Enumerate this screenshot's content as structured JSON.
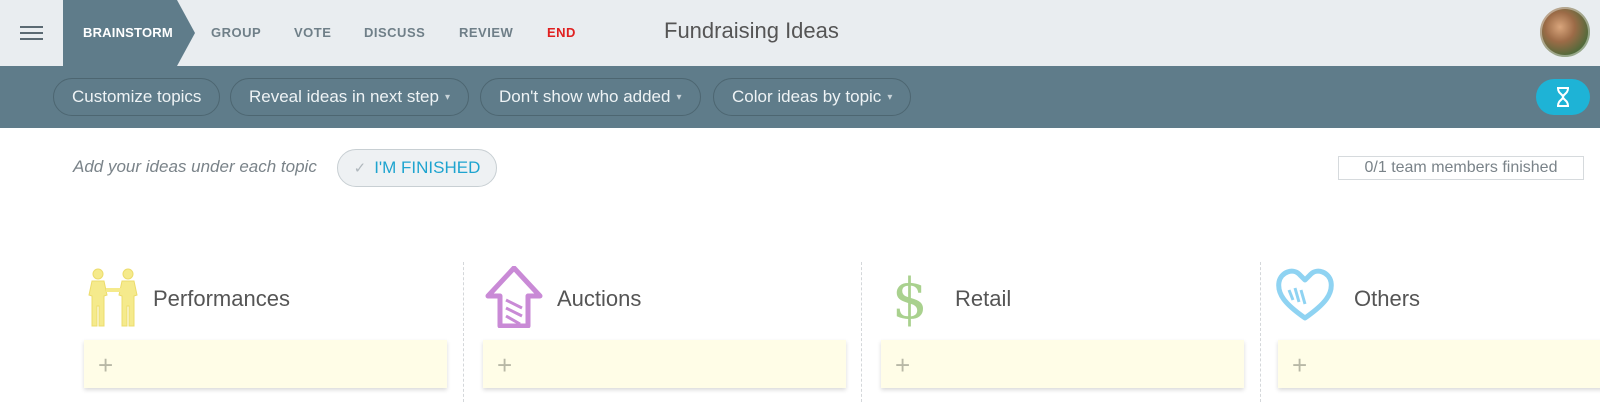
{
  "nav": {
    "steps": [
      {
        "label": "BRAINSTORM",
        "active": true
      },
      {
        "label": "GROUP"
      },
      {
        "label": "VOTE"
      },
      {
        "label": "DISCUSS"
      },
      {
        "label": "REVIEW"
      },
      {
        "label": "END"
      }
    ],
    "board_title": "Fundraising Ideas"
  },
  "toolbar": {
    "customize": "Customize topics",
    "reveal": "Reveal ideas in next step",
    "authors": "Don't show who added",
    "color": "Color ideas by topic",
    "caret": "▾",
    "timer_icon": "hourglass-icon"
  },
  "instruction": {
    "text": "Add your ideas under each topic",
    "finished_label": "I'M FINISHED",
    "check": "✓",
    "members_finished": "0/1 team members finished"
  },
  "topics": [
    {
      "name": "Performances",
      "icon": "people-icon",
      "color": "#f5ea8c"
    },
    {
      "name": "Auctions",
      "icon": "up-arrow-icon",
      "color": "#c98ad6"
    },
    {
      "name": "Retail",
      "icon": "dollar-icon",
      "color": "#a9d18e"
    },
    {
      "name": "Others",
      "icon": "heart-icon",
      "color": "#8fd3f2"
    }
  ],
  "add_symbol": "+",
  "colors": {
    "toolbar": "#5f7c8a",
    "accent": "#1eb3d6",
    "end": "#e02020",
    "card": "#fffde7"
  }
}
